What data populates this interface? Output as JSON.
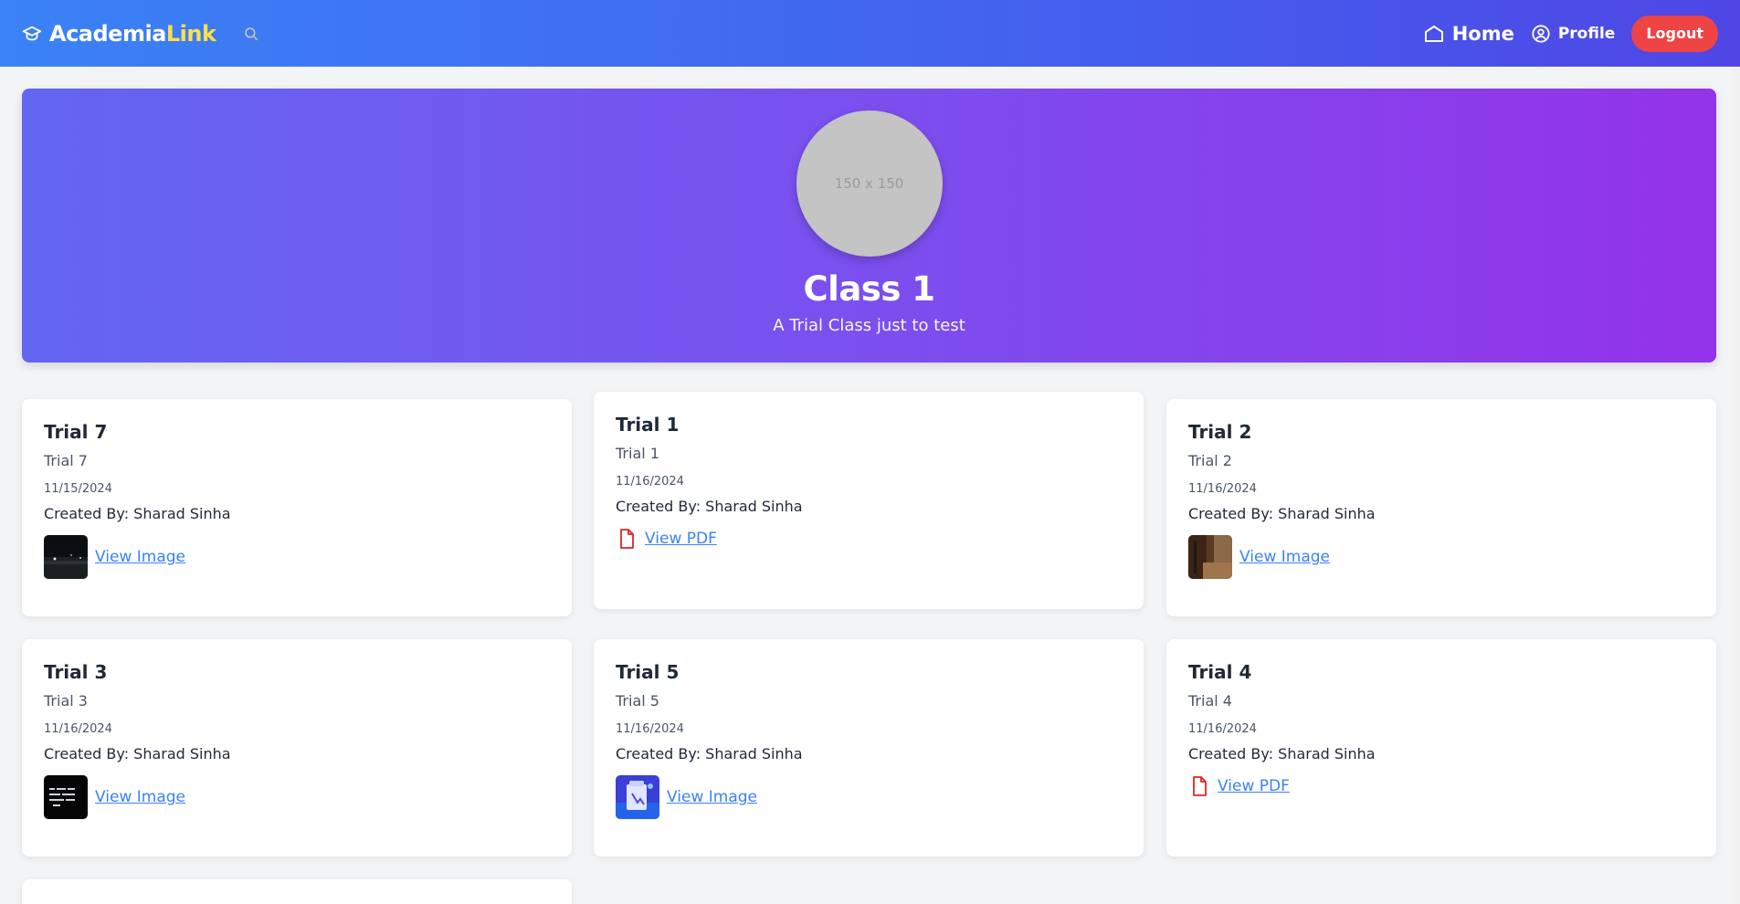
{
  "nav": {
    "brand_main": "Academia",
    "brand_accent": "Link",
    "home_label": "Home",
    "profile_label": "Profile",
    "logout_label": "Logout"
  },
  "hero": {
    "avatar_placeholder": "150 x 150",
    "title": "Class 1",
    "description": "A Trial Class just to test"
  },
  "cards": [
    {
      "title": "Trial 7",
      "description": "Trial 7",
      "date": "11/15/2024",
      "creator": "Created By: Sharad Sinha",
      "attachment_label": "View Image",
      "attachment_type": "image"
    },
    {
      "title": "Trial 1",
      "description": "Trial 1",
      "date": "11/16/2024",
      "creator": "Created By: Sharad Sinha",
      "attachment_label": "View PDF",
      "attachment_type": "pdf"
    },
    {
      "title": "Trial 2",
      "description": "Trial 2",
      "date": "11/16/2024",
      "creator": "Created By: Sharad Sinha",
      "attachment_label": "View Image",
      "attachment_type": "image"
    },
    {
      "title": "Trial 3",
      "description": "Trial 3",
      "date": "11/16/2024",
      "creator": "Created By: Sharad Sinha",
      "attachment_label": "View Image",
      "attachment_type": "image"
    },
    {
      "title": "Trial 5",
      "description": "Trial 5",
      "date": "11/16/2024",
      "creator": "Created By: Sharad Sinha",
      "attachment_label": "View Image",
      "attachment_type": "image"
    },
    {
      "title": "Trial 4",
      "description": "Trial 4",
      "date": "11/16/2024",
      "creator": "Created By: Sharad Sinha",
      "attachment_label": "View PDF",
      "attachment_type": "pdf"
    }
  ],
  "colors": {
    "nav_gradient_start": "#3b82f6",
    "nav_gradient_end": "#4f46e5",
    "hero_gradient_start": "#6366f1",
    "hero_gradient_end": "#9333ea",
    "brand_accent": "#fde047",
    "logout_button": "#ef4444",
    "link": "#3b82f6",
    "pdf_icon": "#dc2626"
  },
  "icons": {
    "brand": "graduation-cap-icon",
    "search": "search-icon",
    "home": "home-icon",
    "profile": "user-circle-icon",
    "pdf": "file-icon"
  }
}
